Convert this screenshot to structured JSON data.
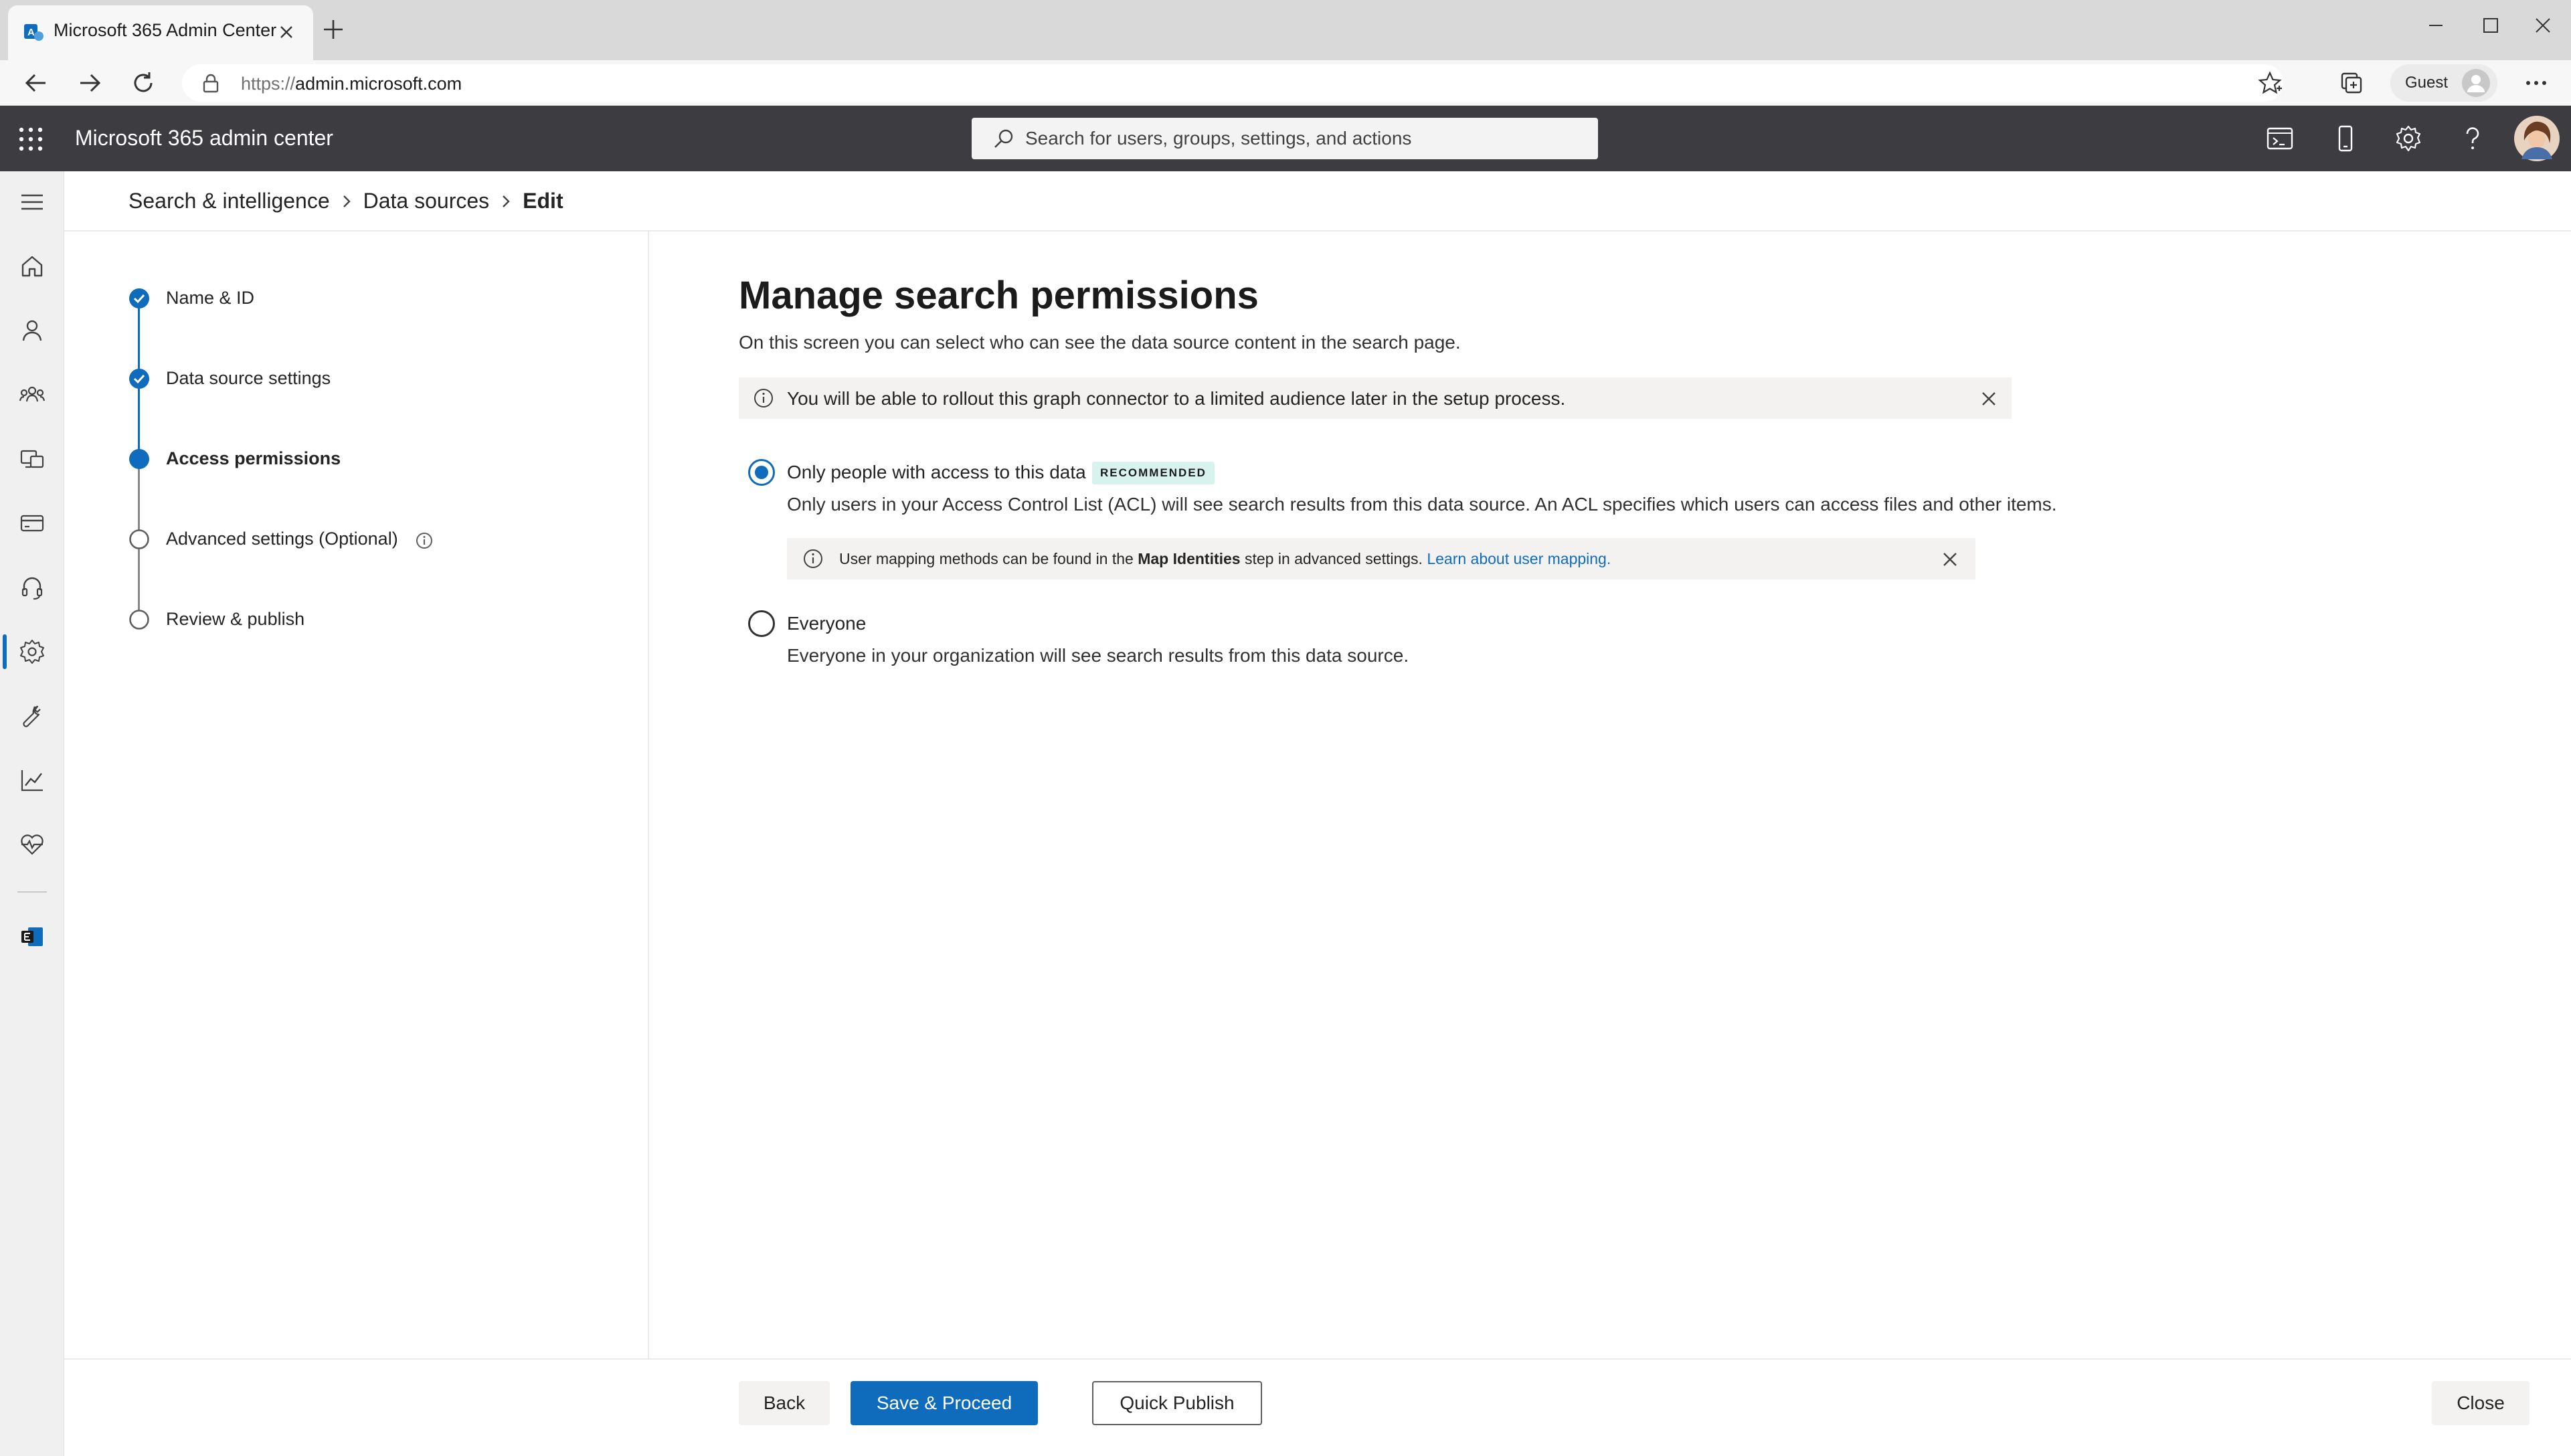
{
  "browser": {
    "tab_title": "Microsoft 365 Admin Center",
    "url_protocol": "https://",
    "url_host": "admin.microsoft.com",
    "profile_label": "Guest"
  },
  "app": {
    "title": "Microsoft 365 admin center",
    "search_placeholder": "Search for users, groups, settings, and actions"
  },
  "breadcrumb": [
    "Search & intelligence",
    "Data sources",
    "Edit"
  ],
  "steps": [
    {
      "label": "Name & ID",
      "state": "done"
    },
    {
      "label": "Data source settings",
      "state": "done"
    },
    {
      "label": "Access permissions",
      "state": "current"
    },
    {
      "label": "Advanced settings (Optional)",
      "state": "pending"
    },
    {
      "label": "Review & publish",
      "state": "pending"
    }
  ],
  "main": {
    "heading": "Manage search permissions",
    "subtitle": "On this screen you can select who can see the data source content in the search page.",
    "info_banner": "You will be able to rollout this graph connector to a limited audience later in the setup process.",
    "option1": {
      "label": "Only people with access to this data",
      "badge": "RECOMMENDED",
      "description": "Only users in your Access Control List (ACL) will see search results from this data source. An ACL specifies which users can access files and other items.",
      "selected": true
    },
    "mapping_banner": {
      "prefix": "User mapping methods can be found in the ",
      "bold": "Map Identities",
      "suffix": " step in advanced settings. ",
      "link": "Learn about user mapping."
    },
    "option2": {
      "label": "Everyone",
      "description": "Everyone in your organization will see search results from this data source.",
      "selected": false
    }
  },
  "footer": {
    "back": "Back",
    "save": "Save & Proceed",
    "quick_publish": "Quick Publish",
    "close": "Close"
  },
  "colors": {
    "accent": "#0f6cbd",
    "header_bg": "#3c3c41",
    "badge_bg": "#d8f3ee"
  }
}
